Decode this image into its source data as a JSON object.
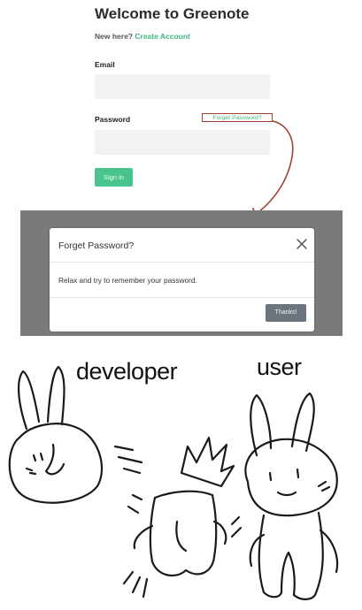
{
  "login": {
    "title": "Welcome to Greenote",
    "new_here": "New here?",
    "create_account": "Create Account",
    "email_label": "Email",
    "email_value": "",
    "password_label": "Password",
    "password_value": "",
    "forgot_link": "Forget Password?",
    "signin_label": "Sign in",
    "accent_color": "#49c48b",
    "annotation_color": "#a54030"
  },
  "modal": {
    "title": "Forget Password?",
    "body": "Relax and try to remember your password.",
    "close_icon": "close-icon",
    "button_label": "Thanks!"
  },
  "meme": {
    "left_caption": "developer",
    "right_caption": "user"
  }
}
